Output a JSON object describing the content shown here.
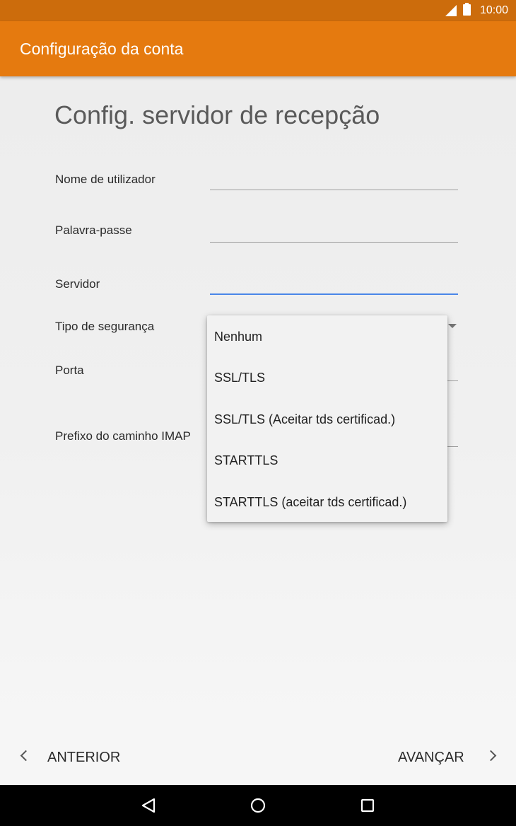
{
  "status_bar": {
    "time": "10:00"
  },
  "app_bar": {
    "title": "Configuração da conta"
  },
  "page": {
    "heading": "Config. servidor de recepção"
  },
  "form": {
    "username_label": "Nome de utilizador",
    "password_label": "Palavra-passe",
    "server_label": "Servidor",
    "security_label": "Tipo de segurança",
    "port_label": "Porta",
    "imap_prefix_label": "Prefixo do caminho IMAP"
  },
  "security_menu": {
    "options": [
      "Nenhum",
      "SSL/TLS",
      "SSL/TLS (Aceitar tds certificad.)",
      "STARTTLS",
      "STARTTLS (aceitar tds certificad.)"
    ]
  },
  "footer": {
    "back_label": "ANTERIOR",
    "next_label": "AVANÇAR"
  },
  "colors": {
    "app_bar": "#e57a0f",
    "status_bar": "#cc6c0c",
    "focus_line": "#4a86e8"
  }
}
